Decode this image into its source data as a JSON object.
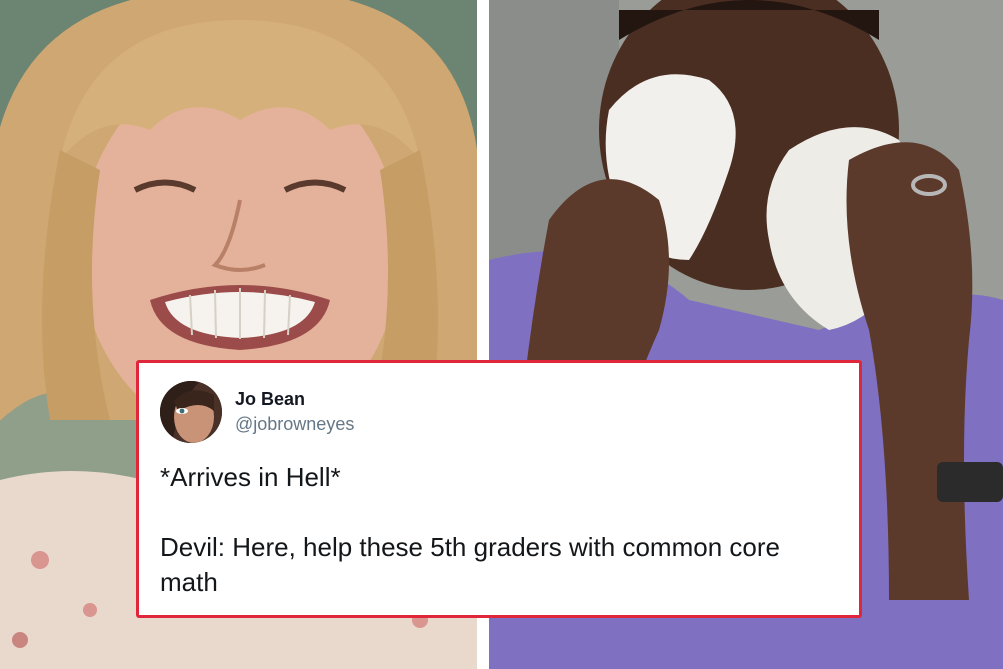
{
  "tweet": {
    "display_name": "Jo Bean",
    "handle": "@jobrowneyes",
    "lines": [
      "*Arrives in Hell*",
      "",
      "Devil: Here, help these 5th graders with common core",
      "math"
    ],
    "border_color": "#e0263a"
  },
  "icons": {
    "avatar": "user-avatar-photo"
  },
  "colors": {
    "accent_border": "#e0263a",
    "handle_gray": "#657786",
    "text_dark": "#14171a"
  }
}
